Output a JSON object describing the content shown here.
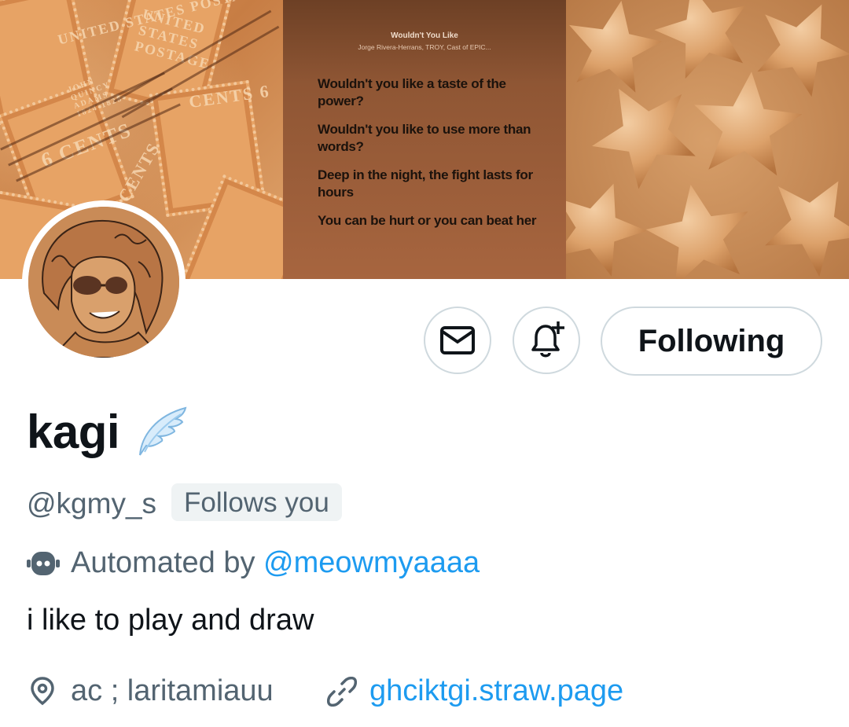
{
  "banner": {
    "song_title": "Wouldn't You Like",
    "song_artist": "Jorge Rivera-Herrans, TROY, Cast of EPIC...",
    "lyrics": [
      "Wouldn't you like a taste of the power?",
      "Wouldn't you like to use more than words?",
      "Deep in the night, the fight lasts for hours",
      "You can be hurt or you can beat her"
    ],
    "stamp_texts": [
      "UNITED STATES POSTAGE",
      "UNITED STATES POSTAGE",
      "6 CENTS",
      "CENTS 6",
      "6 CENTS",
      "JOHN QUINCY ADAMS 1824-1828"
    ]
  },
  "actions": {
    "message_icon": "envelope-icon",
    "notify_icon": "bell-plus-icon",
    "follow_label": "Following"
  },
  "profile": {
    "display_name": "kagi",
    "name_emoji": "wing-icon",
    "handle": "@kgmy_s",
    "follows_you": "Follows you",
    "automated_prefix": "Automated by",
    "automated_by": "@meowmyaaaa",
    "bio": "i like to play and draw",
    "location": "ac ; laritamiauu",
    "website": "ghciktgi.straw.page"
  },
  "colors": {
    "link": "#1d9bf0",
    "muted": "#536471",
    "text": "#0f1419",
    "border": "#cfd9de",
    "badge_bg": "#eff3f4"
  }
}
